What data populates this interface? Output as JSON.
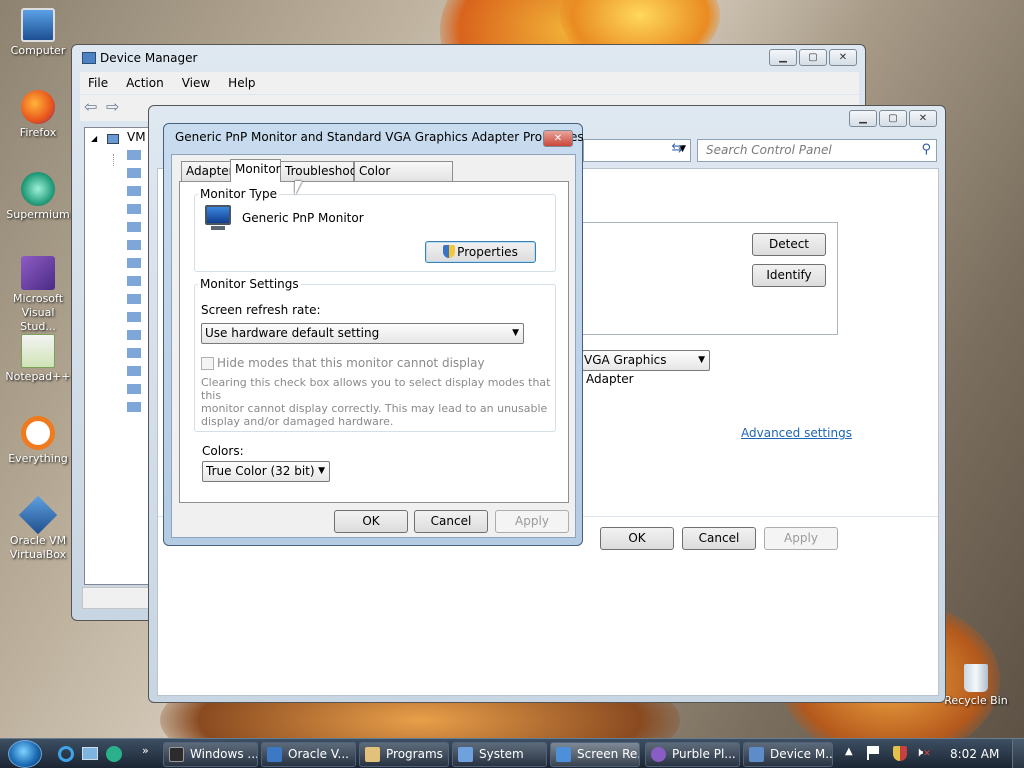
{
  "desktop": {
    "icons": [
      {
        "label1": "Computer",
        "label2": ""
      },
      {
        "label1": "Firefox",
        "label2": ""
      },
      {
        "label1": "Supermium",
        "label2": ""
      },
      {
        "label1": "Microsoft",
        "label2": "Visual Stud..."
      },
      {
        "label1": "Notepad++",
        "label2": ""
      },
      {
        "label1": "Everything",
        "label2": ""
      },
      {
        "label1": "Oracle VM",
        "label2": "VirtualBox"
      }
    ],
    "recycle_bin": "Recycle Bin"
  },
  "device_manager": {
    "title": "Device Manager",
    "menu": [
      "File",
      "Action",
      "View",
      "Help"
    ],
    "tree_root": "VM"
  },
  "control_panel": {
    "search_placeholder": "Search Control Panel",
    "detect": "Detect",
    "identify": "Identify",
    "display_dropdown": "VGA Graphics Adapter",
    "advanced_link": "Advanced settings",
    "ok": "OK",
    "cancel": "Cancel",
    "apply": "Apply"
  },
  "dialog": {
    "title": "Generic PnP Monitor and Standard VGA Graphics Adapter Properties",
    "tabs": [
      "Adapter",
      "Monitor",
      "Troubleshoot",
      "Color Management"
    ],
    "active_tab": "Monitor",
    "monitor_type_label": "Monitor Type",
    "monitor_name": "Generic PnP Monitor",
    "properties_button": "Properties",
    "monitor_settings_label": "Monitor Settings",
    "refresh_label": "Screen refresh rate:",
    "refresh_value": "Use hardware default setting",
    "hide_modes_label": "Hide modes that this monitor cannot display",
    "hide_modes_checked": false,
    "note_line1": "Clearing this check box allows you to select display modes that this",
    "note_line2": "monitor cannot display correctly. This may lead to an unusable",
    "note_line3": "display and/or damaged hardware.",
    "colors_label": "Colors:",
    "colors_value": "True Color (32 bit)",
    "ok": "OK",
    "cancel": "Cancel",
    "apply": "Apply"
  },
  "taskbar": {
    "tasks": [
      "Windows ...",
      "Oracle V...",
      "Programs",
      "System",
      "Screen Re...",
      "Purble Pl...",
      "Device M..."
    ],
    "active_task": "Screen Re...",
    "clock": "8:02 AM"
  },
  "colors": {
    "accent": "#1e66b4",
    "link": "#1e66b4",
    "taskbar": "#243140"
  }
}
